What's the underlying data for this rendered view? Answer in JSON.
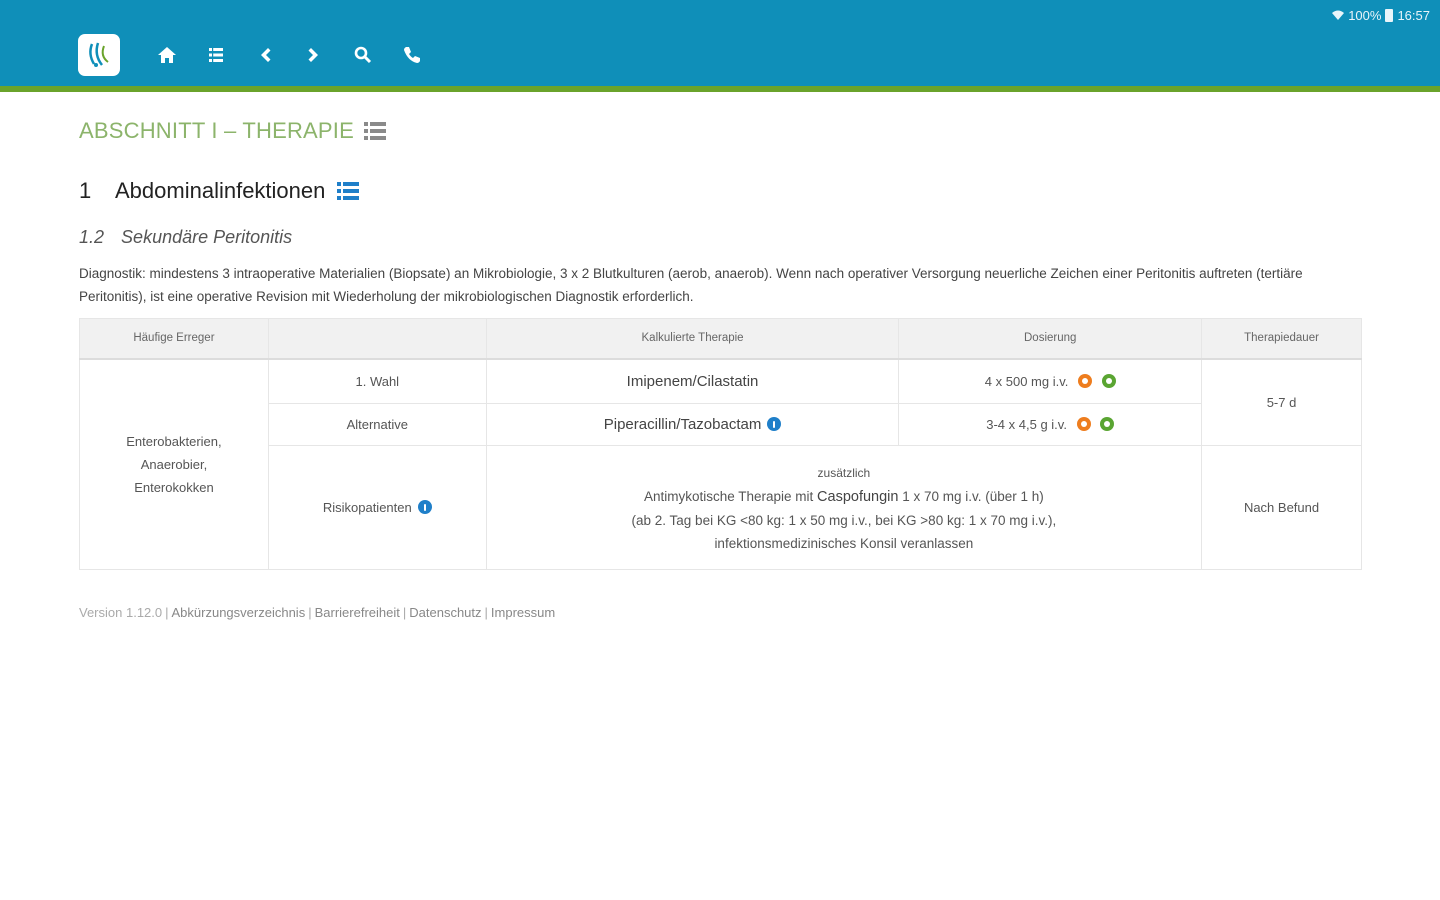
{
  "status": {
    "signal": "100%",
    "time": "16:57"
  },
  "toolbar": {
    "buttons": [
      "home-icon",
      "list-icon",
      "chevron-left-icon",
      "chevron-right-icon",
      "search-icon",
      "phone-icon"
    ]
  },
  "section": {
    "title": "ABSCHNITT I – THERAPIE"
  },
  "chapter": {
    "num": "1",
    "title": "Abdominalinfektionen"
  },
  "subsection": {
    "num": "1.2",
    "title": "Sekundäre Peritonitis"
  },
  "diagnostics": "Diagnostik: mindestens 3 intraoperative Materialien (Biopsate) an Mikrobiologie, 3 x 2 Blutkulturen (aerob, anaerob). Wenn nach operativer Versorgung neuerliche Zeichen einer Peritonitis auftreten (tertiäre Peritonitis), ist eine operative Revision mit Wiederholung der mikrobiologischen Diagnostik erforderlich.",
  "table": {
    "headers": {
      "pathogens": "Häufige Erreger",
      "choice": "",
      "therapy": "Kalkulierte Therapie",
      "dosage": "Dosierung",
      "duration": "Therapiedauer"
    },
    "pathogens": [
      "Enterobakterien,",
      "Anaerobier,",
      "Enterokokken"
    ],
    "row1": {
      "choice": "1. Wahl",
      "drug": "Imipenem/Cilastatin",
      "dose": "4 x 500 mg i.v."
    },
    "row2": {
      "choice": "Alternative",
      "drug": "Piperacillin/Tazobactam",
      "dose": "3-4 x 4,5 g i.v."
    },
    "duration_1": "5-7 d",
    "row3": {
      "choice": "Risikopatienten",
      "line1": "zusätzlich",
      "line2a": "Antimykotische Therapie mit ",
      "line2b": "Caspofungin",
      "line2c": " 1 x 70 mg i.v. (über 1 h)",
      "line3": "(ab 2. Tag bei KG <80 kg: 1 x 50 mg i.v., bei KG >80 kg: 1 x 70 mg i.v.),",
      "line4": "infektionsmedizinisches Konsil veranlassen",
      "duration": "Nach Befund"
    }
  },
  "footer": {
    "version": "Version 1.12.0",
    "links": [
      "Abkürzungsverzeichnis",
      "Barrierefreiheit",
      "Datenschutz",
      "Impressum"
    ]
  },
  "colors": {
    "header": "#0f8fb9",
    "stripe": "#6aa32b",
    "section": "#8cb46b",
    "info": "#1f7fc9",
    "orange": "#ee7d1e",
    "green": "#5aa532"
  }
}
